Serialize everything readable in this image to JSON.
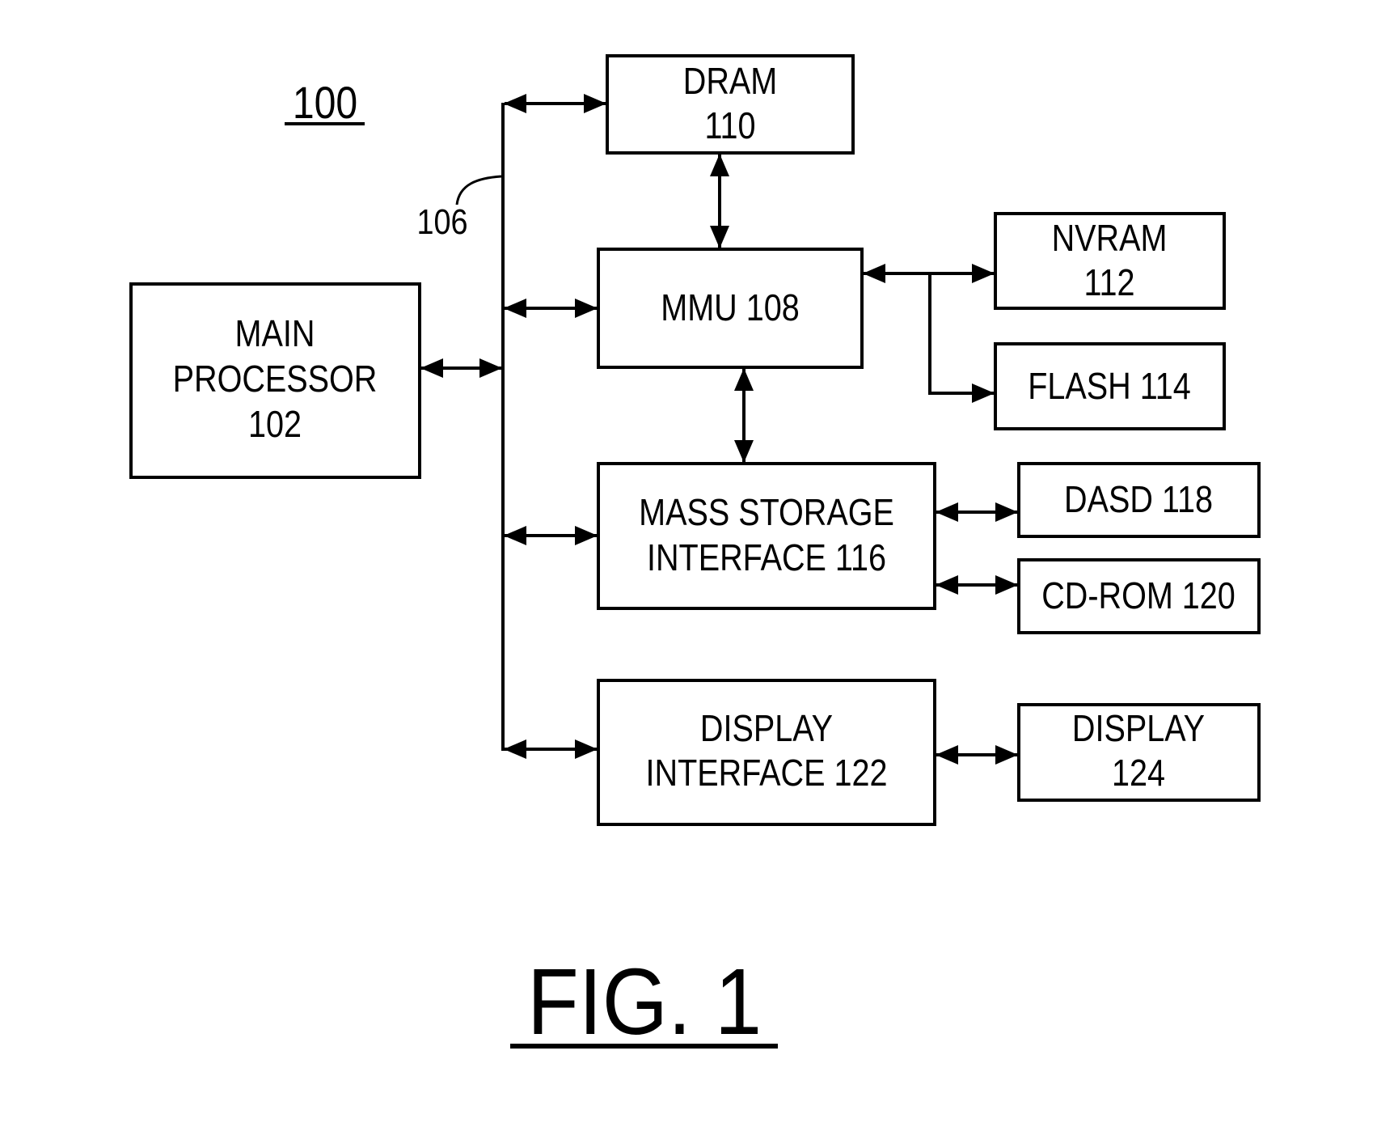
{
  "figure": {
    "system_ref": "100",
    "bus_ref": "106",
    "caption": "FIG. 1"
  },
  "blocks": {
    "main_processor": {
      "line1": "MAIN",
      "line2": "PROCESSOR",
      "line3": "102"
    },
    "dram": {
      "line1": "DRAM",
      "line2": "110"
    },
    "mmu": {
      "line1": "MMU 108"
    },
    "nvram": {
      "line1": "NVRAM",
      "line2": "112"
    },
    "flash": {
      "line1": "FLASH 114"
    },
    "mass_storage": {
      "line1": "MASS STORAGE",
      "line2": "INTERFACE 116"
    },
    "dasd": {
      "line1": "DASD 118"
    },
    "cdrom": {
      "line1": "CD-ROM 120"
    },
    "display_interface": {
      "line1": "DISPLAY",
      "line2": "INTERFACE 122"
    },
    "display": {
      "line1": "DISPLAY",
      "line2": "124"
    }
  },
  "connections": [
    {
      "from": "main_processor",
      "to": "bus_106",
      "type": "bidirectional"
    },
    {
      "from": "bus_106",
      "to": "dram",
      "type": "bidirectional"
    },
    {
      "from": "bus_106",
      "to": "mmu",
      "type": "bidirectional"
    },
    {
      "from": "bus_106",
      "to": "mass_storage",
      "type": "bidirectional"
    },
    {
      "from": "bus_106",
      "to": "display_interface",
      "type": "bidirectional"
    },
    {
      "from": "dram",
      "to": "mmu",
      "type": "bidirectional"
    },
    {
      "from": "mmu",
      "to": "mass_storage",
      "type": "bidirectional"
    },
    {
      "from": "mmu",
      "to": "nvram",
      "type": "bidirectional"
    },
    {
      "from": "mmu",
      "to": "flash",
      "type": "unidirectional"
    },
    {
      "from": "mass_storage",
      "to": "dasd",
      "type": "bidirectional"
    },
    {
      "from": "mass_storage",
      "to": "cdrom",
      "type": "bidirectional"
    },
    {
      "from": "display_interface",
      "to": "display",
      "type": "bidirectional"
    }
  ]
}
